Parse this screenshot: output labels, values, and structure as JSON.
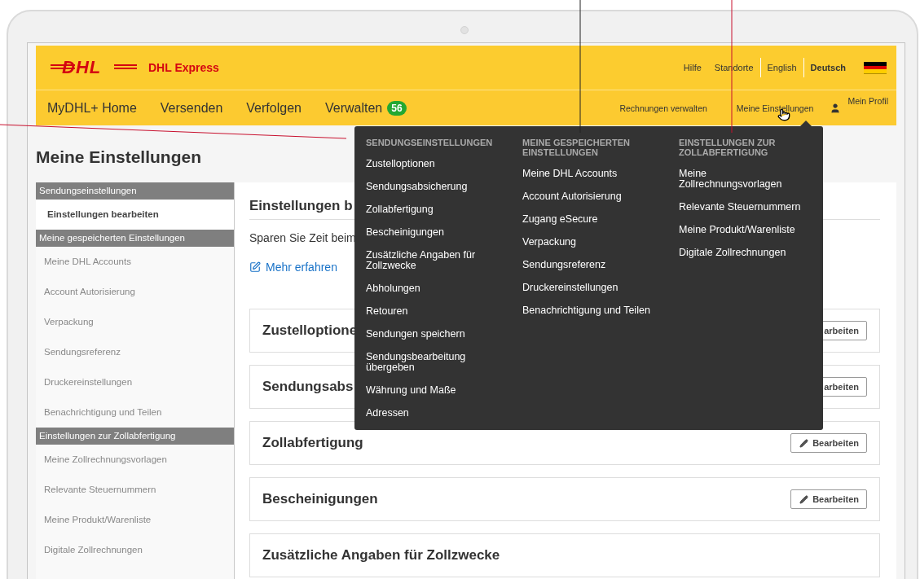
{
  "logo": {
    "mark": "DHL",
    "name": "DHL Express"
  },
  "top_links": [
    "Hilfe",
    "Standorte"
  ],
  "languages": [
    {
      "label": "English",
      "selected": false
    },
    {
      "label": "Deutsch",
      "selected": true
    }
  ],
  "nav": {
    "items": [
      {
        "label": "MyDHL+ Home"
      },
      {
        "label": "Versenden"
      },
      {
        "label": "Verfolgen"
      },
      {
        "label": "Verwalten",
        "badge": "56"
      }
    ],
    "right": [
      "Rechnungen verwalten",
      "Meine Einstellungen"
    ],
    "profile": "Mein Profil"
  },
  "page_title": "Meine Einstellungen",
  "sidebar": {
    "sections": [
      {
        "title": "Sendungseinstellungen",
        "items": [
          {
            "label": "Einstellungen bearbeiten",
            "selected": true
          }
        ]
      },
      {
        "title": "Meine gespeicherten Einstellungen",
        "items": [
          {
            "label": "Meine DHL Accounts",
            "selected": false
          },
          {
            "label": "Account Autorisierung",
            "selected": false
          },
          {
            "label": "Verpackung",
            "selected": false
          },
          {
            "label": "Sendungsreferenz",
            "selected": false
          },
          {
            "label": "Druckereinstellungen",
            "selected": false
          },
          {
            "label": "Benachrichtigung und Teilen",
            "selected": false
          }
        ]
      },
      {
        "title": "Einstellungen zur Zollabfertigung",
        "items": [
          {
            "label": "Meine Zollrechnungsvorlagen",
            "selected": false
          },
          {
            "label": "Relevante Steuernummern",
            "selected": false
          },
          {
            "label": "Meine Produkt/Warenliste",
            "selected": false
          },
          {
            "label": "Digitale Zollrechnungen",
            "selected": false
          }
        ]
      }
    ]
  },
  "content": {
    "heading": "Einstellungen b",
    "intro": "Sparen Sie Zeit beim",
    "link": "Mehr erfahren",
    "cards": [
      {
        "title": "Zustelloptione",
        "button": {
          "kind": "cut",
          "label": "arbeiten"
        }
      },
      {
        "title": "Sendungsabs",
        "button": {
          "kind": "cut",
          "label": "arbeiten"
        }
      },
      {
        "title": "Zollabfertigung",
        "button": {
          "kind": "full",
          "label": "Bearbeiten"
        }
      },
      {
        "title": "Bescheinigungen",
        "button": {
          "kind": "full",
          "label": "Bearbeiten"
        }
      },
      {
        "title": "Zusätzliche Angaben für Zollzwecke"
      }
    ]
  },
  "dropdown": {
    "columns": [
      {
        "heading": "SENDUNGSEINSTELLUNGEN",
        "items": [
          "Zustelloptionen",
          "Sendungsabsicherung",
          "Zollabfertigung",
          "Bescheinigungen",
          "Zusätzliche Angaben für Zollzwecke",
          "Abholungen",
          "Retouren",
          "Sendungen speichern",
          "Sendungsbearbeitung übergeben",
          "Währung und Maße",
          "Adressen"
        ]
      },
      {
        "heading": "MEINE GESPEICHERTEN EINSTELLUNGEN",
        "items": [
          "Meine DHL Accounts",
          "Account Autorisierung",
          "Zugang eSecure",
          "Verpackung",
          "Sendungsreferenz",
          "Druckereinstellungen",
          "Benachrichtigung und Teilen"
        ]
      },
      {
        "heading": "EINSTELLUNGEN ZUR ZOLLABFERTIGUNG",
        "items": [
          "Meine Zollrechnungsvorlagen",
          "Relevante Steuernummern",
          "Meine Produkt/Warenliste",
          "Digitale Zollrechnungen"
        ]
      }
    ]
  }
}
